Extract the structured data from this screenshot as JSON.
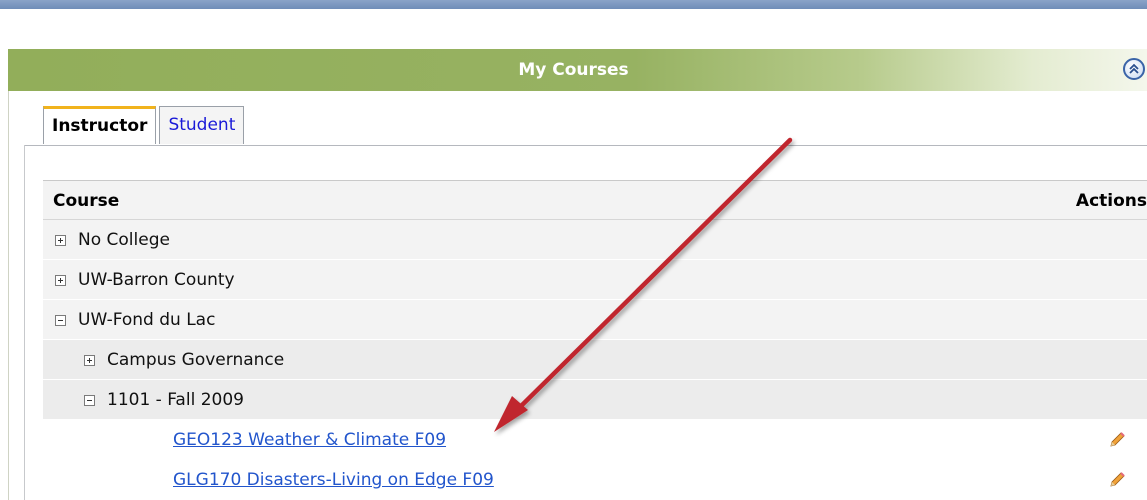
{
  "portlet": {
    "title": "My Courses"
  },
  "tabs": [
    {
      "label": "Instructor",
      "active": true
    },
    {
      "label": "Student",
      "active": false
    }
  ],
  "table": {
    "col_course": "Course",
    "col_actions": "Actions",
    "rows": [
      {
        "label": "No College",
        "toggle": "plus"
      },
      {
        "label": "UW-Barron County",
        "toggle": "plus"
      },
      {
        "label": "UW-Fond du Lac",
        "toggle": "minus"
      },
      {
        "label": "Campus Governance",
        "toggle": "plus"
      },
      {
        "label": "1101 - Fall 2009",
        "toggle": "minus"
      },
      {
        "label": "GEO123 Weather & Climate F09",
        "link": true
      },
      {
        "label": "GLG170 Disasters-Living on Edge F09",
        "link": true
      }
    ]
  },
  "colors": {
    "header_green": "#92ae5a",
    "link_blue": "#2255cc",
    "tab_accent": "#f1b31c",
    "annotation_arrow": "#c0272d"
  },
  "icons": {
    "collapse": "double-chevron-up-icon",
    "edit": "pencil-icon"
  }
}
